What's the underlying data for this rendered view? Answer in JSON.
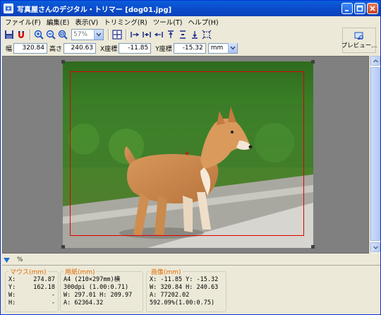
{
  "window": {
    "title": "写真屋さんのデジタル・トリマー [dog01.jpg]"
  },
  "menu": [
    {
      "label": "ファイル(F)"
    },
    {
      "label": "編集(E)"
    },
    {
      "label": "表示(V)"
    },
    {
      "label": "トリミング(R)"
    },
    {
      "label": "ツール(T)"
    },
    {
      "label": "ヘルプ(H)"
    }
  ],
  "toolbar": {
    "zoom_value": "57%",
    "preview_label": "プレビュー..."
  },
  "dims": {
    "width_label": "幅",
    "width_value": "320.84",
    "height_label": "高さ",
    "height_value": "240.63",
    "x_label": "X座標",
    "x_value": "-11.85",
    "y_label": "Y座標",
    "y_value": "-15.32",
    "unit": "mm"
  },
  "panel_toggle": {
    "label": "%"
  },
  "mouse": {
    "legend": "マウス(mm)",
    "rows": [
      {
        "k": "X:",
        "v": "274.87"
      },
      {
        "k": "Y:",
        "v": "162.18"
      },
      {
        "k": "W:",
        "v": "-"
      },
      {
        "k": "H:",
        "v": "-"
      }
    ]
  },
  "paper": {
    "legend": "用紙(mm)",
    "line1": "A4 (210×297mm)横",
    "line2": "300dpi (1.00:0.71)",
    "line3": "W: 297.01  H: 209.97",
    "line4": "A: 62364.32"
  },
  "image": {
    "legend": "画像(mm)",
    "line1": "X: -11.85  Y: -15.32",
    "line2": "W: 320.84  H: 240.63",
    "line3": "A: 77202.02",
    "line4": "592.09%(1.00:0.75)"
  },
  "colors": {
    "title_bar": "#0a5fd9",
    "crop_frame": "#e00000",
    "legend_text": "#e06a00",
    "canvas_bg": "#808080"
  }
}
